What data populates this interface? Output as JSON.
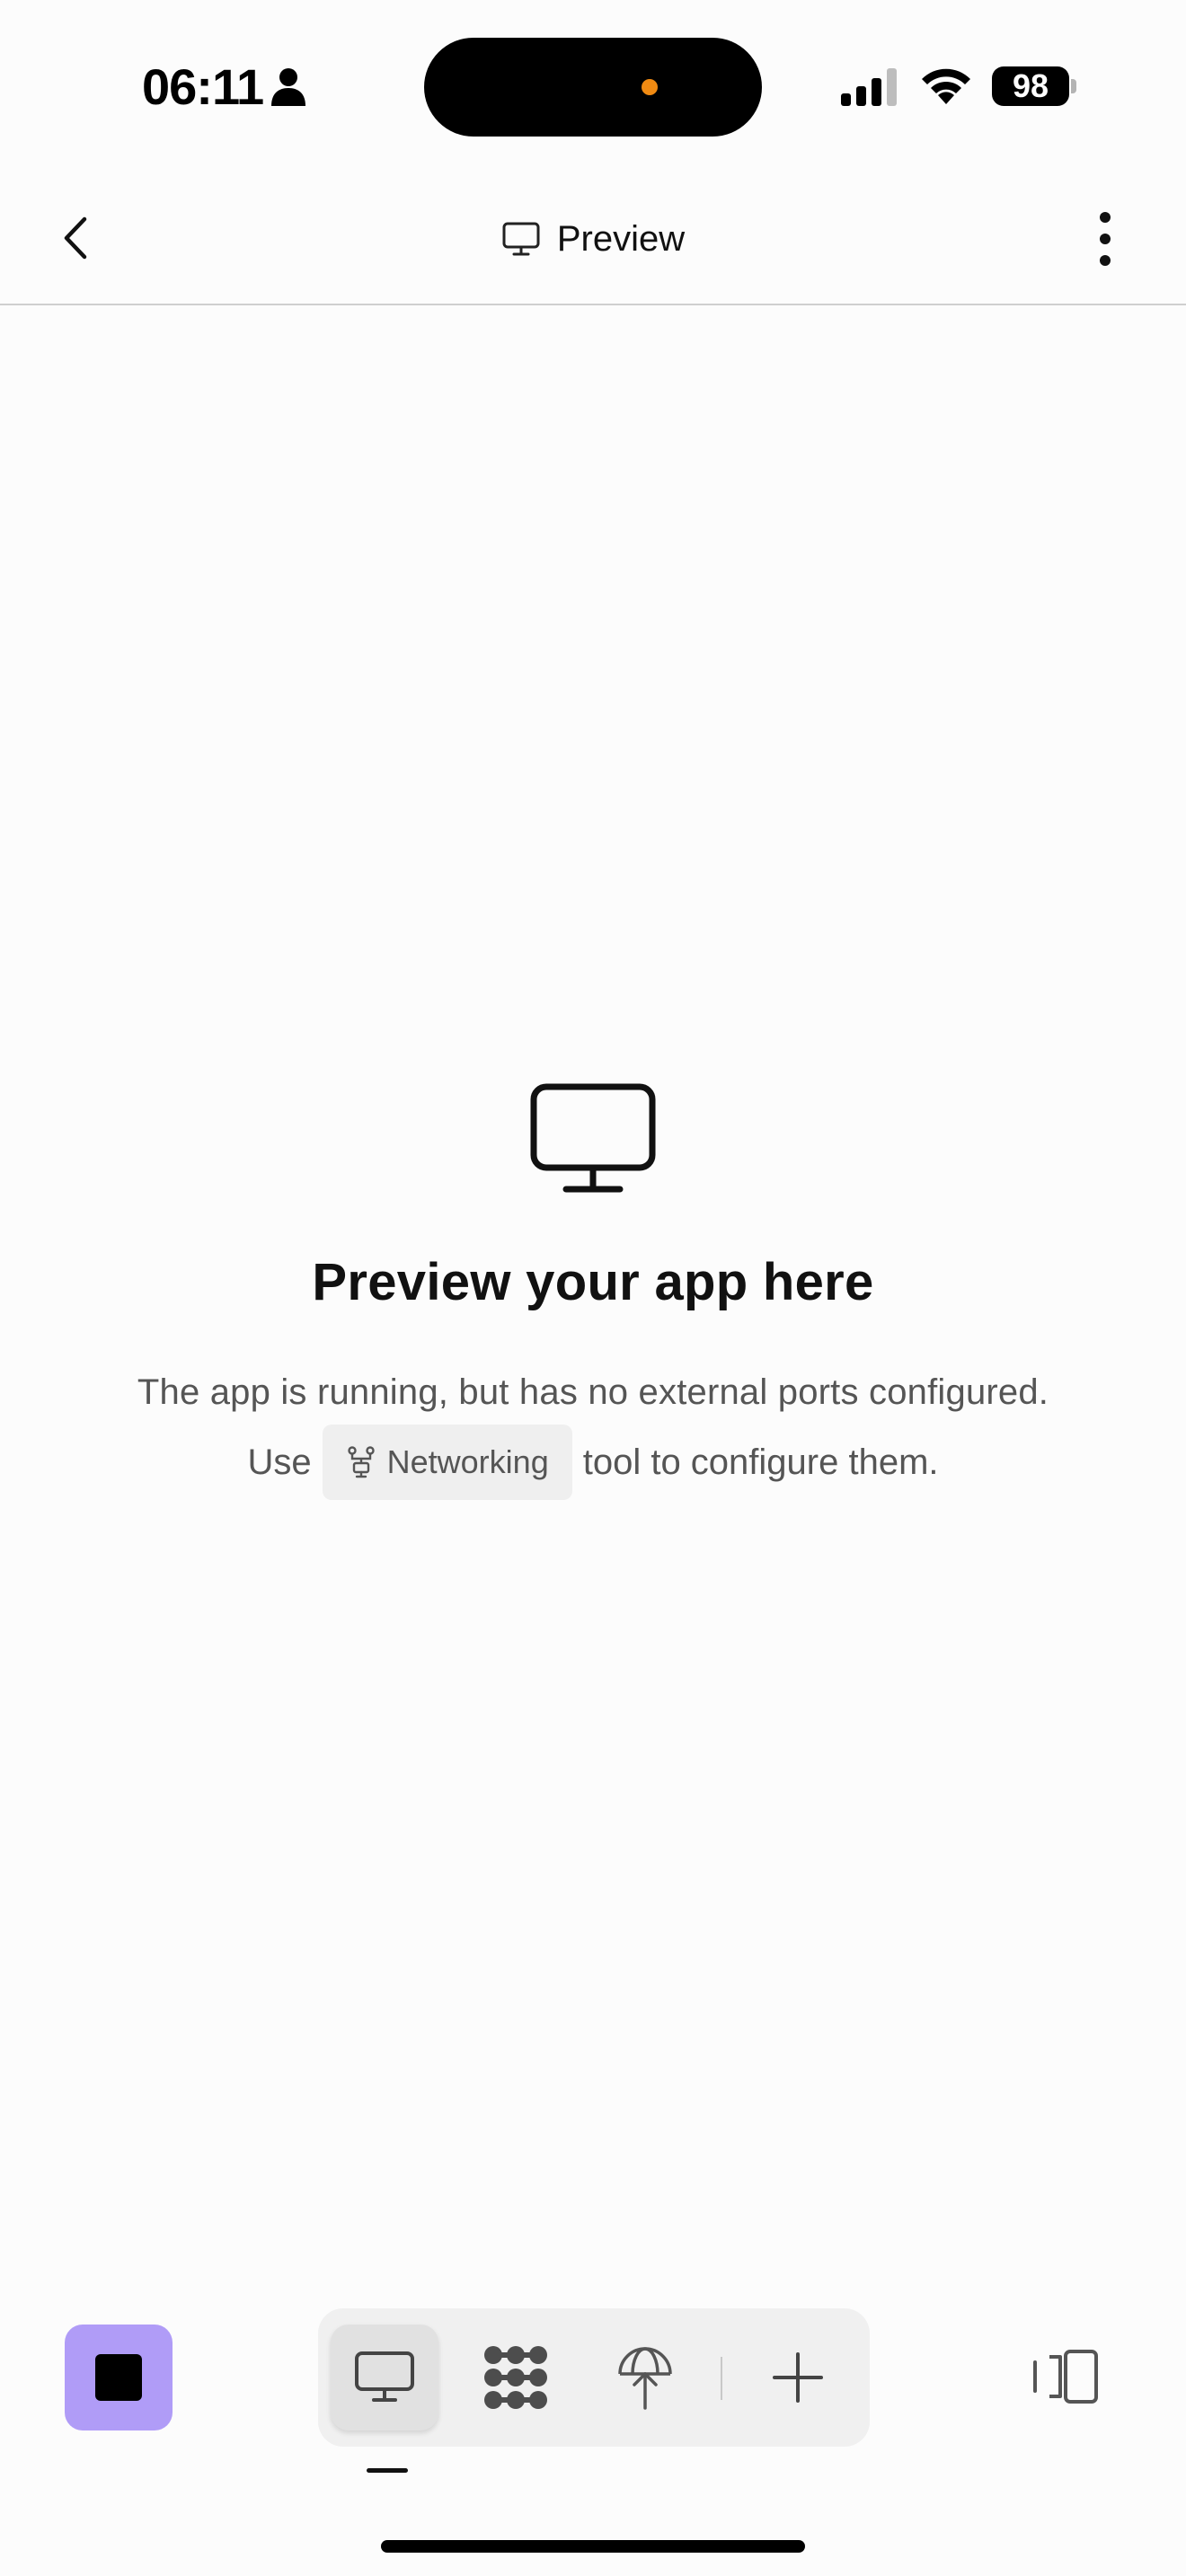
{
  "status_bar": {
    "time": "06:11",
    "battery": "98",
    "icons": [
      "person-icon",
      "signal-icon",
      "wifi-icon"
    ],
    "island_dot_color": "#f08a12"
  },
  "header": {
    "title": "Preview",
    "title_icon": "monitor-icon",
    "back_icon": "chevron-left-icon",
    "more_icon": "more-vertical-icon"
  },
  "empty_state": {
    "icon": "monitor-icon",
    "title": "Preview your app here",
    "line1": "The app is running, but has no external ports configured.",
    "line2_prefix": "Use",
    "chip_label": "Networking",
    "chip_icon": "network-icon",
    "line2_suffix": "tool to configure them."
  },
  "bottom_bar": {
    "stop_color": "#b09cf7",
    "tools": [
      {
        "name": "preview",
        "icon": "monitor-icon",
        "active": true
      },
      {
        "name": "shell",
        "icon": "dots-grid-icon",
        "active": false
      },
      {
        "name": "deploy",
        "icon": "publish-globe-icon",
        "active": false
      },
      {
        "name": "add",
        "icon": "plus-icon",
        "active": false
      }
    ],
    "panels_icon": "panels-icon"
  }
}
